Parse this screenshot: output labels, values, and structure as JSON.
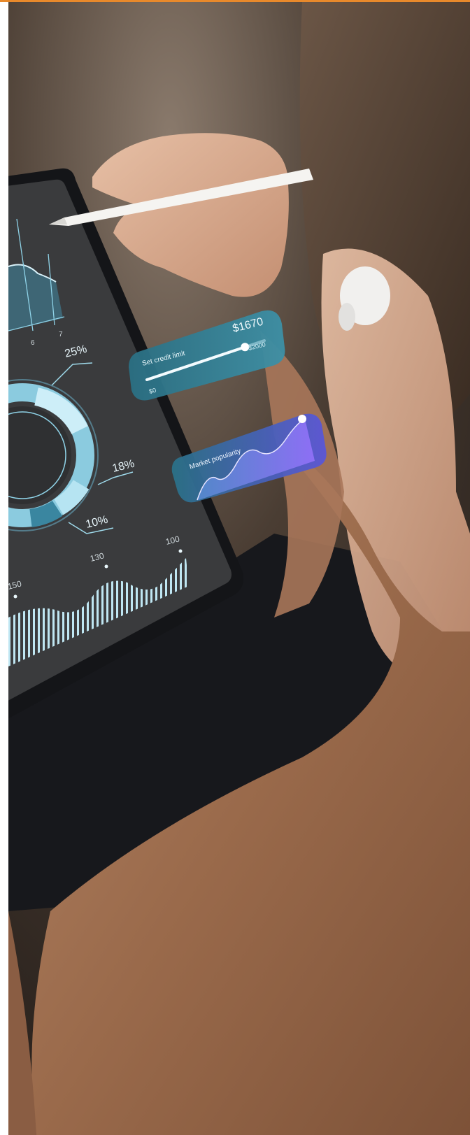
{
  "colors": {
    "accent_bar": "#e8892b",
    "tablet_screen": "#3a3b3d",
    "sweater": "#9a6a4b",
    "chart_teal": "#8fd3e8",
    "widget_teal": "#2d7f93",
    "widget_purple": "#5b4fd6"
  },
  "icons": {
    "stylus": "stylus-icon",
    "earbud": "earbud-icon"
  },
  "tablet": {
    "line_chart_ticks": [
      "6",
      "7"
    ],
    "donut": {
      "labels": [
        "25%",
        "18%",
        "10%"
      ],
      "values": [
        25,
        18,
        10
      ]
    },
    "wave_chart": {
      "labels": [
        "150",
        "130",
        "100"
      ],
      "values": [
        150,
        130,
        100
      ]
    }
  },
  "credit_widget": {
    "title": "Set credit limit",
    "value": "$1670",
    "min_label": "$0",
    "max_label": "$2000",
    "slider_fraction": 0.835
  },
  "popularity_widget": {
    "title": "Market popularity"
  }
}
